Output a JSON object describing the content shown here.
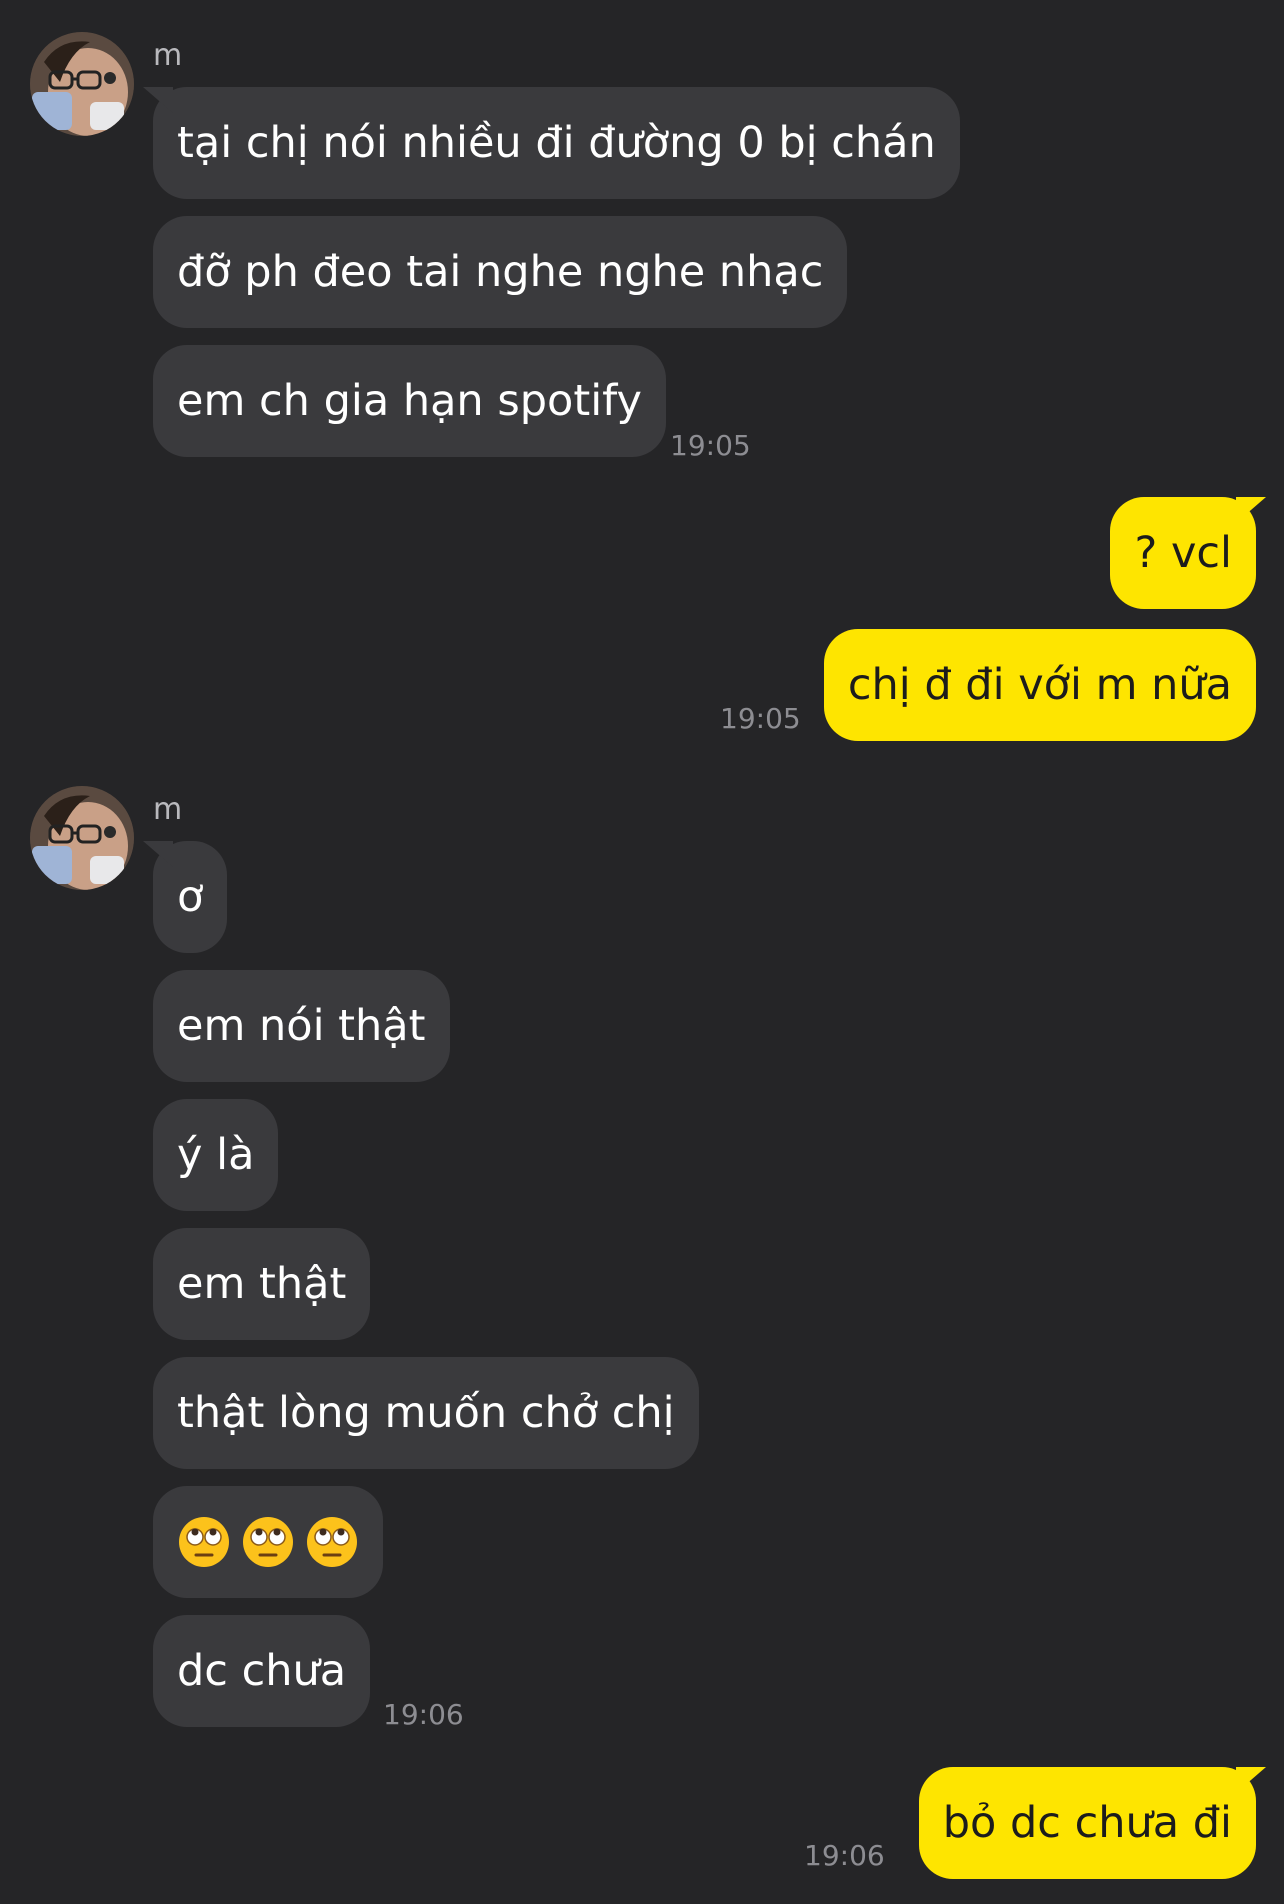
{
  "colors": {
    "background": "#252527",
    "incoming_bubble": "#3a3a3d",
    "outgoing_bubble": "#fee500",
    "timestamp": "#8d8d92"
  },
  "groups": [
    {
      "sender": "m",
      "messages": [
        "tại chị nói nhiều đi đường 0 bị chán",
        "đỡ ph đeo tai nghe nghe nhạc",
        "em ch gia hạn spotify"
      ],
      "time": "19:05"
    },
    {
      "sender": "me",
      "messages": [
        "? vcl",
        "chị đ đi với m nữa"
      ],
      "time": "19:05"
    },
    {
      "sender": "m",
      "messages": [
        "ơ",
        "em nói thật",
        "ý là",
        "em thật",
        "thật lòng muốn chở chị",
        "emoji-row",
        "dc chưa"
      ],
      "emoji_row": [
        "face-with-rolling-eyes",
        "face-with-rolling-eyes",
        "face-with-rolling-eyes"
      ],
      "time": "19:06"
    },
    {
      "sender": "me",
      "messages": [
        "bỏ dc chưa đi"
      ],
      "time": "19:06"
    }
  ]
}
